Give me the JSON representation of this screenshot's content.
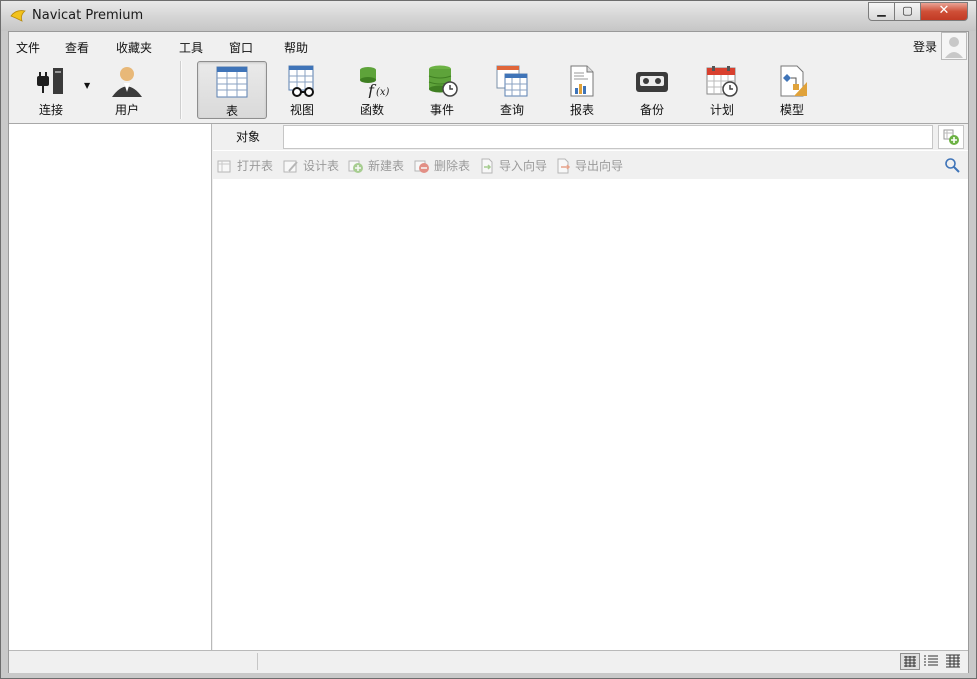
{
  "window": {
    "title": "Navicat Premium"
  },
  "colors": {
    "accent_close": "#c23a24",
    "toolbar_bg": "#f0f0f0"
  },
  "menu": [
    "文件",
    "查看",
    "收藏夹",
    "工具",
    "窗口",
    "帮助"
  ],
  "account": {
    "login_label": "登录",
    "avatar_icon": "user-avatar-icon"
  },
  "toolbar": {
    "connect": {
      "label": "连接",
      "icon": "plug-icon"
    },
    "user": {
      "label": "用户",
      "icon": "user-icon"
    },
    "objects": [
      {
        "label": "表",
        "icon": "table-icon",
        "active": true
      },
      {
        "label": "视图",
        "icon": "view-icon"
      },
      {
        "label": "函数",
        "icon": "function-icon"
      },
      {
        "label": "事件",
        "icon": "event-icon"
      },
      {
        "label": "查询",
        "icon": "query-icon"
      },
      {
        "label": "报表",
        "icon": "report-icon"
      },
      {
        "label": "备份",
        "icon": "backup-icon"
      },
      {
        "label": "计划",
        "icon": "schedule-icon"
      },
      {
        "label": "模型",
        "icon": "model-icon"
      }
    ]
  },
  "object_panel": {
    "tab_label": "对象",
    "filter_value": "",
    "actions": [
      {
        "label": "打开表",
        "icon": "open-table-icon"
      },
      {
        "label": "设计表",
        "icon": "design-table-icon"
      },
      {
        "label": "新建表",
        "icon": "new-table-icon"
      },
      {
        "label": "删除表",
        "icon": "delete-table-icon"
      },
      {
        "label": "导入向导",
        "icon": "import-wizard-icon"
      },
      {
        "label": "导出向导",
        "icon": "export-wizard-icon"
      }
    ]
  },
  "status": {
    "view_modes": [
      "icon-view-icon",
      "list-view-icon",
      "detail-view-icon"
    ],
    "selected_view": "icon-view-icon"
  }
}
